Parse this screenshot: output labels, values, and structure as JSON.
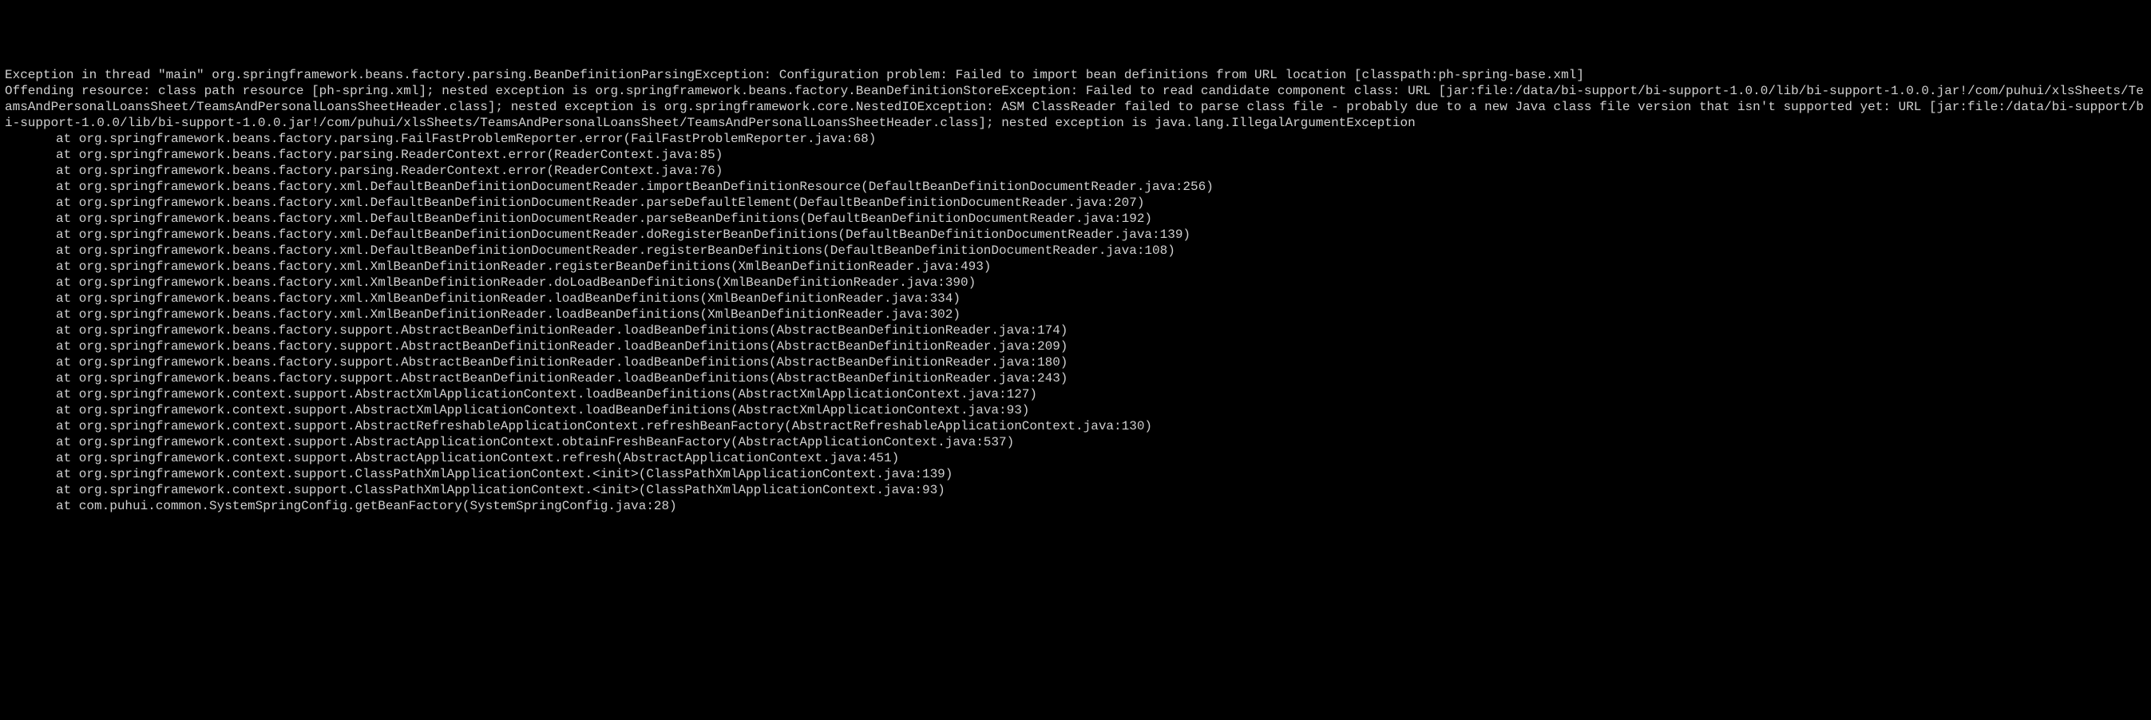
{
  "terminal": {
    "exception_lines": [
      "Exception in thread \"main\" org.springframework.beans.factory.parsing.BeanDefinitionParsingException: Configuration problem: Failed to import bean definitions from URL location [classpath:ph-spring-base.xml]",
      "Offending resource: class path resource [ph-spring.xml]; nested exception is org.springframework.beans.factory.BeanDefinitionStoreException: Failed to read candidate component class: URL [jar:file:/data/bi-support/bi-support-1.0.0/lib/bi-support-1.0.0.jar!/com/puhui/xlsSheets/TeamsAndPersonalLoansSheet/TeamsAndPersonalLoansSheetHeader.class]; nested exception is org.springframework.core.NestedIOException: ASM ClassReader failed to parse class file - probably due to a new Java class file version that isn't supported yet: URL [jar:file:/data/bi-support/bi-support-1.0.0/lib/bi-support-1.0.0.jar!/com/puhui/xlsSheets/TeamsAndPersonalLoansSheet/TeamsAndPersonalLoansSheetHeader.class]; nested exception is java.lang.IllegalArgumentException"
    ],
    "stack_trace": [
      "at org.springframework.beans.factory.parsing.FailFastProblemReporter.error(FailFastProblemReporter.java:68)",
      "at org.springframework.beans.factory.parsing.ReaderContext.error(ReaderContext.java:85)",
      "at org.springframework.beans.factory.parsing.ReaderContext.error(ReaderContext.java:76)",
      "at org.springframework.beans.factory.xml.DefaultBeanDefinitionDocumentReader.importBeanDefinitionResource(DefaultBeanDefinitionDocumentReader.java:256)",
      "at org.springframework.beans.factory.xml.DefaultBeanDefinitionDocumentReader.parseDefaultElement(DefaultBeanDefinitionDocumentReader.java:207)",
      "at org.springframework.beans.factory.xml.DefaultBeanDefinitionDocumentReader.parseBeanDefinitions(DefaultBeanDefinitionDocumentReader.java:192)",
      "at org.springframework.beans.factory.xml.DefaultBeanDefinitionDocumentReader.doRegisterBeanDefinitions(DefaultBeanDefinitionDocumentReader.java:139)",
      "at org.springframework.beans.factory.xml.DefaultBeanDefinitionDocumentReader.registerBeanDefinitions(DefaultBeanDefinitionDocumentReader.java:108)",
      "at org.springframework.beans.factory.xml.XmlBeanDefinitionReader.registerBeanDefinitions(XmlBeanDefinitionReader.java:493)",
      "at org.springframework.beans.factory.xml.XmlBeanDefinitionReader.doLoadBeanDefinitions(XmlBeanDefinitionReader.java:390)",
      "at org.springframework.beans.factory.xml.XmlBeanDefinitionReader.loadBeanDefinitions(XmlBeanDefinitionReader.java:334)",
      "at org.springframework.beans.factory.xml.XmlBeanDefinitionReader.loadBeanDefinitions(XmlBeanDefinitionReader.java:302)",
      "at org.springframework.beans.factory.support.AbstractBeanDefinitionReader.loadBeanDefinitions(AbstractBeanDefinitionReader.java:174)",
      "at org.springframework.beans.factory.support.AbstractBeanDefinitionReader.loadBeanDefinitions(AbstractBeanDefinitionReader.java:209)",
      "at org.springframework.beans.factory.support.AbstractBeanDefinitionReader.loadBeanDefinitions(AbstractBeanDefinitionReader.java:180)",
      "at org.springframework.beans.factory.support.AbstractBeanDefinitionReader.loadBeanDefinitions(AbstractBeanDefinitionReader.java:243)",
      "at org.springframework.context.support.AbstractXmlApplicationContext.loadBeanDefinitions(AbstractXmlApplicationContext.java:127)",
      "at org.springframework.context.support.AbstractXmlApplicationContext.loadBeanDefinitions(AbstractXmlApplicationContext.java:93)",
      "at org.springframework.context.support.AbstractRefreshableApplicationContext.refreshBeanFactory(AbstractRefreshableApplicationContext.java:130)",
      "at org.springframework.context.support.AbstractApplicationContext.obtainFreshBeanFactory(AbstractApplicationContext.java:537)",
      "at org.springframework.context.support.AbstractApplicationContext.refresh(AbstractApplicationContext.java:451)",
      "at org.springframework.context.support.ClassPathXmlApplicationContext.<init>(ClassPathXmlApplicationContext.java:139)",
      "at org.springframework.context.support.ClassPathXmlApplicationContext.<init>(ClassPathXmlApplicationContext.java:93)",
      "at com.puhui.common.SystemSpringConfig.getBeanFactory(SystemSpringConfig.java:28)"
    ]
  }
}
